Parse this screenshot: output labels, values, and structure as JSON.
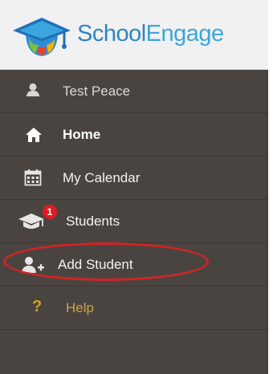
{
  "brand": {
    "school": "School",
    "engage": "Engage"
  },
  "sidebar": {
    "items": [
      {
        "label": "Test Peace",
        "icon": "user-icon"
      },
      {
        "label": "Home",
        "icon": "home-icon"
      },
      {
        "label": "My Calendar",
        "icon": "calendar-icon"
      },
      {
        "label": "Students",
        "icon": "graduation-cap-icon",
        "badge": "1"
      },
      {
        "label": "Add Student",
        "icon": "add-user-icon"
      },
      {
        "label": "Help",
        "icon": "question-icon",
        "glyph": "?"
      }
    ]
  },
  "colors": {
    "sidebar_bg": "#4a4441",
    "header_bg": "#f1f1f1",
    "brand_blue": "#2e84c4",
    "help_text": "#c9a24a",
    "badge": "#e01b24",
    "annotation_circle": "#d42323"
  }
}
